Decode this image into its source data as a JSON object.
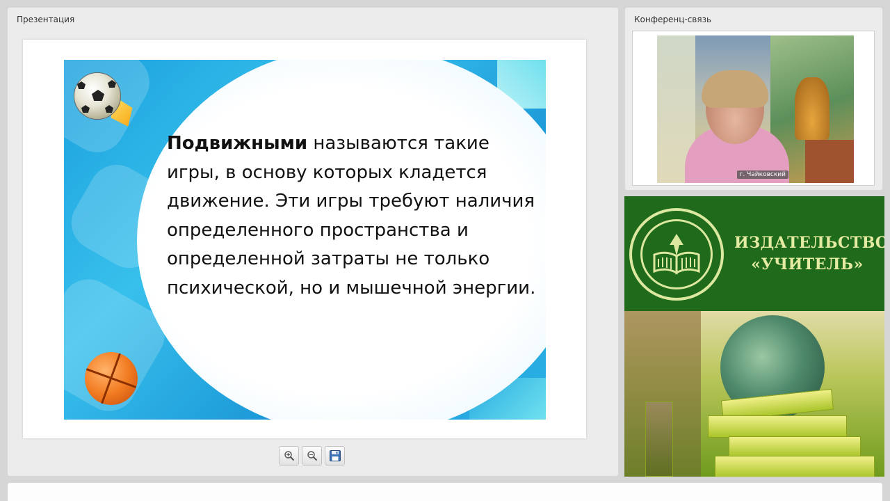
{
  "presentation": {
    "title": "Презентация",
    "slide": {
      "bold_word": "Подвижными",
      "text": " называются такие игры, в основу которых кладется движение. Эти игры требуют наличия определенного пространства и определенной затраты не только психической, но и мышечной энергии."
    },
    "toolbar": {
      "zoom_in_icon": "zoom-in-icon",
      "zoom_out_icon": "zoom-out-icon",
      "save_icon": "save-icon"
    }
  },
  "conference": {
    "title": "Конференц-связь",
    "video_label": "г. Чайковский"
  },
  "banner": {
    "line1": "ИЗДАТЕЛЬСТВО",
    "line2": "«УЧИТЕЛЬ»",
    "colors": {
      "green": "#1f6a1b",
      "text": "#e6eba3"
    }
  }
}
